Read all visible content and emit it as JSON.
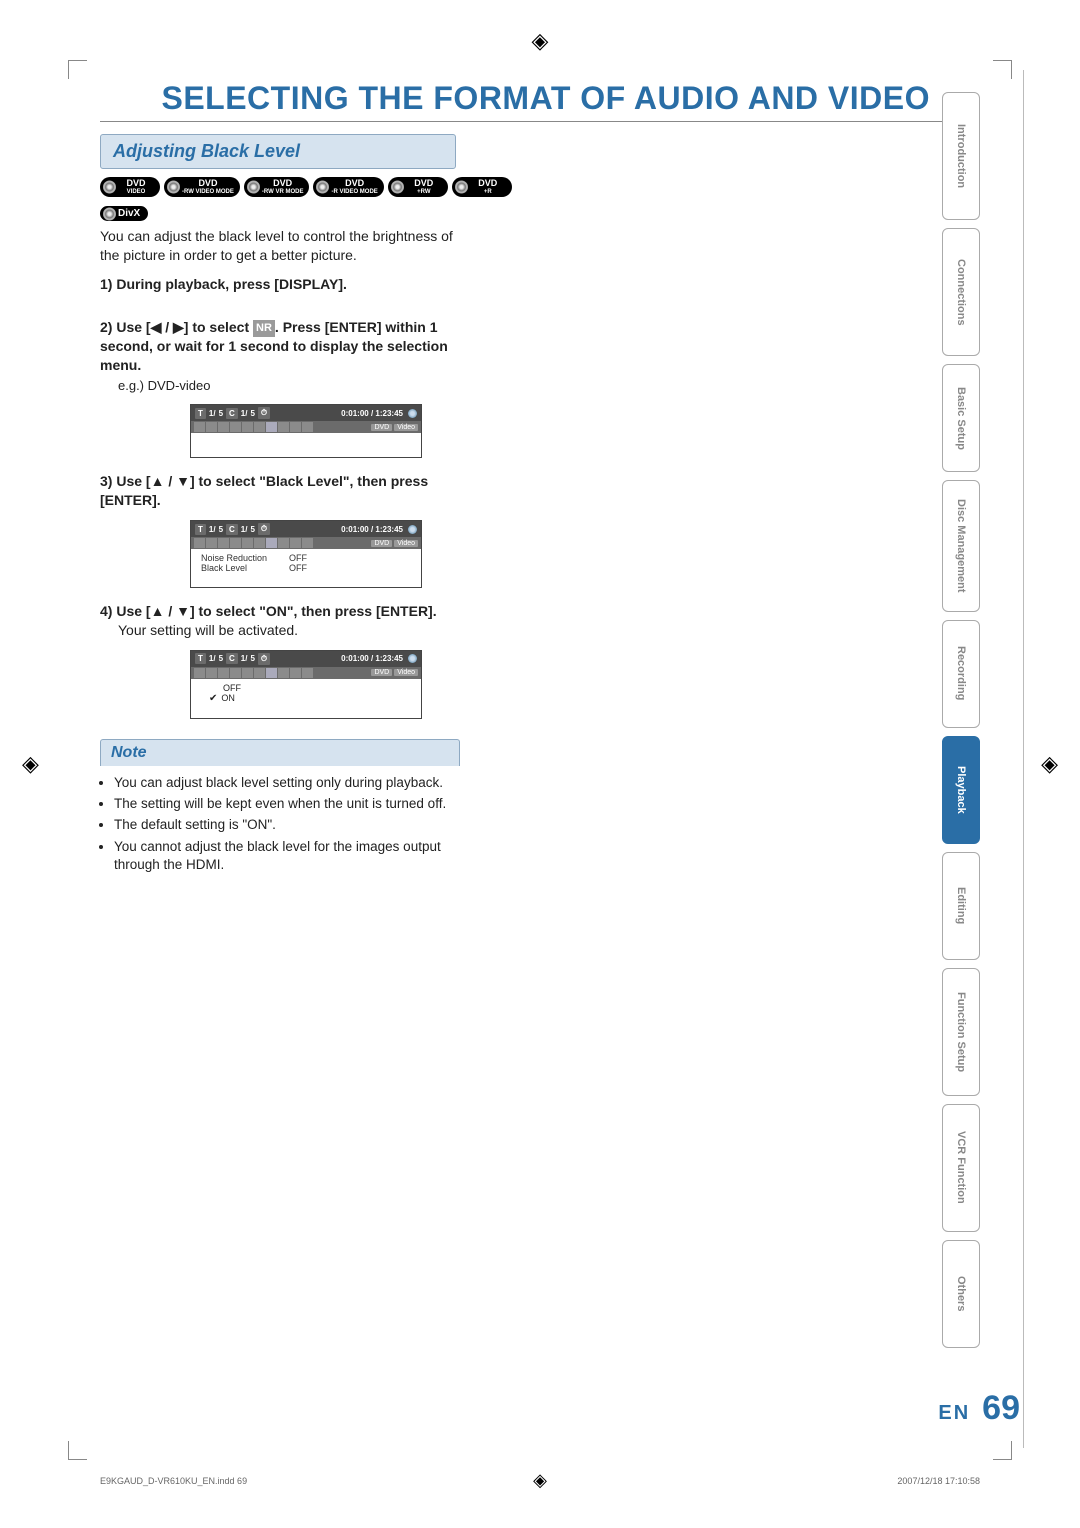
{
  "header": {
    "title": "SELECTING THE FORMAT OF AUDIO AND VIDEO"
  },
  "section": {
    "title": "Adjusting Black Level"
  },
  "badges": [
    {
      "main": "DVD",
      "sub": "VIDEO"
    },
    {
      "main": "DVD",
      "sub": "-RW VIDEO MODE"
    },
    {
      "main": "DVD",
      "sub": "-RW VR MODE"
    },
    {
      "main": "DVD",
      "sub": "-R VIDEO MODE"
    },
    {
      "main": "DVD",
      "sub": "+RW"
    },
    {
      "main": "DVD",
      "sub": "+R"
    }
  ],
  "divx": "DivX",
  "intro": "You can adjust the black level to control the brightness of the picture in order to get a better picture.",
  "steps": {
    "s1_label": "1)",
    "s1_text": "During playback, press [DISPLAY].",
    "s2_label": "2)",
    "s2_pre": "Use [",
    "s2_mid": "] to select ",
    "s2_nr": "NR",
    "s2_post": ". Press [ENTER] within  1 second, or wait for 1 second to display the selection menu.",
    "s2_eg": "e.g.) DVD-video",
    "s3_label": "3)",
    "s3_text": "Use [▲ / ▼] to select \"Black Level\", then press [ENTER].",
    "s4_label": "4)",
    "s4_text": "Use [▲ / ▼] to select \"ON\", then press [ENTER].",
    "s4_after": "Your setting will be activated."
  },
  "arrows": {
    "lr": "◀ / ▶"
  },
  "osd": {
    "top_left_a": "1/",
    "top_left_b": "5",
    "top_left_c": "1/",
    "top_left_d": "5",
    "time": "0:01:00 / 1:23:45",
    "dvd": "DVD",
    "video": "Video",
    "menu_row1_k": "Noise Reduction",
    "menu_row1_v": "OFF",
    "menu_row2_k": "Black Level",
    "menu_row2_v": "OFF",
    "opt_off": "OFF",
    "opt_on": "ON"
  },
  "note": {
    "title": "Note",
    "items": [
      "You can adjust black level setting only during playback.",
      "The setting will be kept even when the unit is turned off.",
      "The default setting is \"ON\".",
      "You cannot adjust the black level for the images output through the HDMI."
    ]
  },
  "tabs": [
    "Introduction",
    "Connections",
    "Basic Setup",
    "Disc Management",
    "Recording",
    "Playback",
    "Editing",
    "Function Setup",
    "VCR Function",
    "Others"
  ],
  "active_tab_index": 5,
  "footer": {
    "lang": "EN",
    "page": "69"
  },
  "printline": {
    "file": "E9KGAUD_D-VR610KU_EN.indd   69",
    "date": "2007/12/18   17:10:58"
  },
  "reg_mark": "◈"
}
